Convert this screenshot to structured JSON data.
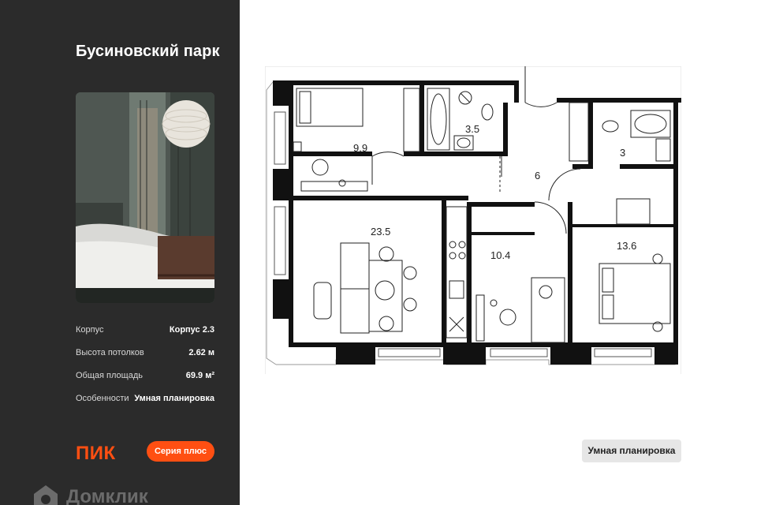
{
  "project": {
    "title": "Бусиновский парк"
  },
  "specs": [
    {
      "label": "Корпус",
      "value": "Корпус 2.3"
    },
    {
      "label": "Высота потолков",
      "value": "2.62 м"
    },
    {
      "label": "Общая площадь",
      "value": "69.9 м²"
    },
    {
      "label": "Особенности",
      "value": "Умная планировка"
    }
  ],
  "brand": {
    "logo": "ПИК",
    "series": "Серия плюс"
  },
  "rooms": [
    {
      "area": "9.9"
    },
    {
      "area": "3.5"
    },
    {
      "area": "6"
    },
    {
      "area": "3"
    },
    {
      "area": "23.5"
    },
    {
      "area": "10.4"
    },
    {
      "area": "13.6"
    }
  ],
  "badge": "Умная планировка",
  "footer": {
    "domclick": "Домклик",
    "icon": "domclick-house-icon"
  },
  "colors": {
    "brand": "#ff4f12",
    "sidebar": "#2b2b2b",
    "wall": "#111111"
  }
}
